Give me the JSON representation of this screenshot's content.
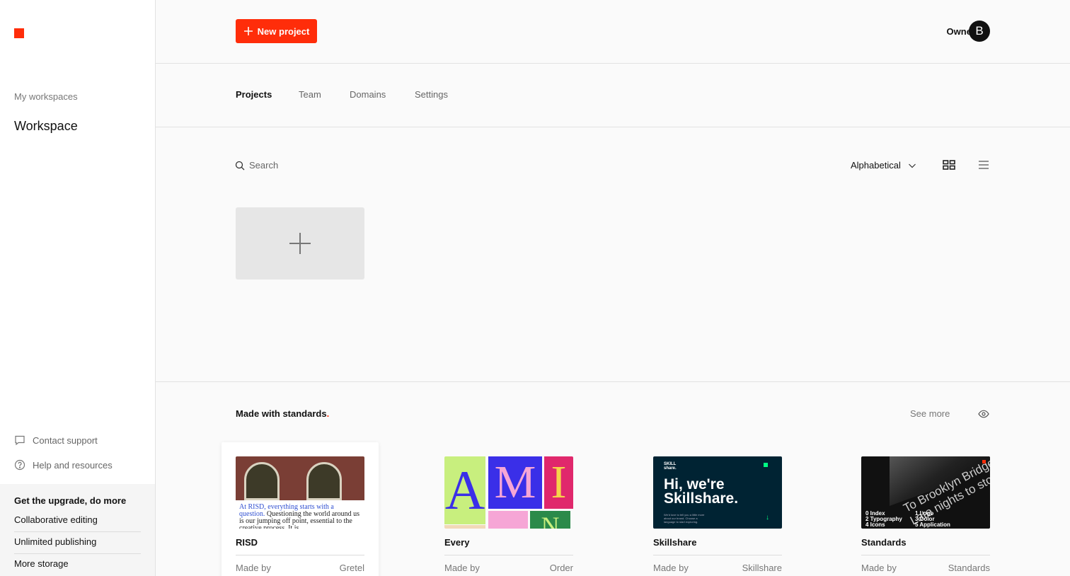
{
  "sidebar": {
    "workspaces_label": "My workspaces",
    "workspace_name": "Workspace",
    "contact_support": "Contact support",
    "help_resources": "Help and resources",
    "upgrade": {
      "title": "Get the upgrade, do more",
      "items": [
        "Collaborative editing",
        "Unlimited publishing",
        "More storage"
      ]
    }
  },
  "header": {
    "new_project_label": "New project",
    "owner_label": "Owner",
    "avatar_initial": "B"
  },
  "tabs": [
    {
      "label": "Projects",
      "active": true
    },
    {
      "label": "Team",
      "active": false
    },
    {
      "label": "Domains",
      "active": false
    },
    {
      "label": "Settings",
      "active": false
    }
  ],
  "toolbar": {
    "search_placeholder": "Search",
    "sort_label": "Alphabetical"
  },
  "showcase": {
    "title": "Made with standards",
    "title_dot": ".",
    "see_more": "See more",
    "made_by_label": "Made by",
    "cards": [
      {
        "name": "RISD",
        "author": "Gretel"
      },
      {
        "name": "Every",
        "author": "Order"
      },
      {
        "name": "Skillshare",
        "author": "Skillshare"
      },
      {
        "name": "Standards",
        "author": "Standards"
      }
    ],
    "risd_thumb": {
      "blue_text": "At RISD, everything starts with a question.",
      "black_text": "Questioning the world around us is our jumping off point, essential to the creative process. It is"
    },
    "every_thumb": {
      "letters": [
        "A",
        "M",
        "I",
        "N"
      ]
    },
    "skillshare_thumb": {
      "logo_line1": "SKILL",
      "logo_line2": "share.",
      "headline_line1": "Hi, we're",
      "headline_line2": "Skillshare.",
      "body": "We'd love to tell you a little more about our brand. Choose a language to start exploring."
    },
    "standards_thumb": {
      "sign_text": "To Brooklyn Bridge",
      "sign_text2": "Late nights to",
      "sign_text3": "stops here",
      "list_left": [
        "0  Index",
        "2  Typography",
        "4  Icons"
      ],
      "list_right": [
        "1  Logo",
        "3  Color",
        "5  Application"
      ]
    }
  },
  "colors": {
    "accent": "#ff2d0a"
  }
}
